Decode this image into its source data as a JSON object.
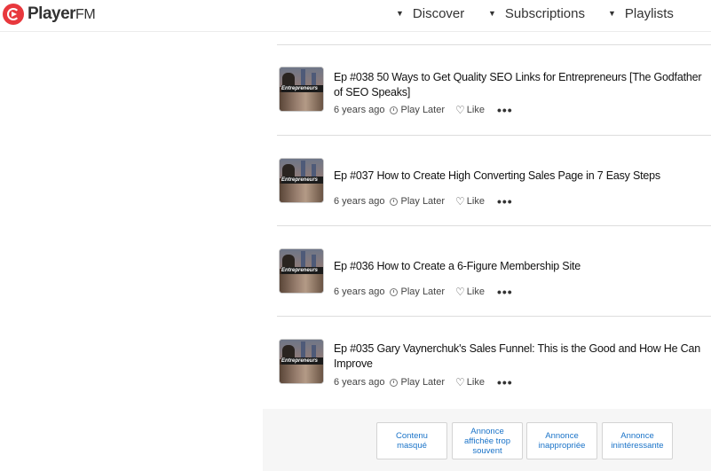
{
  "header": {
    "logo_text": "Player",
    "logo_suffix": "FM",
    "nav": [
      {
        "label": "Discover"
      },
      {
        "label": "Subscriptions"
      },
      {
        "label": "Playlists"
      }
    ]
  },
  "episodes": [
    {
      "title": "Ep #038 50 Ways to Get Quality SEO Links for Entrepreneurs [The Godfather of SEO Speaks]",
      "age": "6 years ago",
      "play_label": "Play Later",
      "like_label": "Like",
      "thumb_text": "Entrepreneurs"
    },
    {
      "title": "Ep #037 How to Create High Converting Sales Page in 7 Easy Steps",
      "age": "6 years ago",
      "play_label": "Play Later",
      "like_label": "Like",
      "thumb_text": "Entrepreneurs"
    },
    {
      "title": "Ep #036 How to Create a 6-Figure Membership Site",
      "age": "6 years ago",
      "play_label": "Play Later",
      "like_label": "Like",
      "thumb_text": "Entrepreneurs"
    },
    {
      "title": "Ep #035 Gary Vaynerchuk's Sales Funnel: This is the Good and How He Can Improve",
      "age": "6 years ago",
      "play_label": "Play Later",
      "like_label": "Like",
      "thumb_text": "Entrepreneurs"
    }
  ],
  "ad_feedback": [
    {
      "label": "Contenu masqué"
    },
    {
      "label": "Annonce affichée trop souvent"
    },
    {
      "label": "Annonce inappropriée"
    },
    {
      "label": "Annonce inintéressante"
    }
  ],
  "colors": {
    "brand": "#e8383d",
    "link": "#1a73c8"
  },
  "icons": {
    "logo": "playerfm-logo-icon",
    "nav_caret": "caret-down-icon",
    "play_later": "clock-icon",
    "like": "heart-icon",
    "more": "more-dots-icon"
  }
}
